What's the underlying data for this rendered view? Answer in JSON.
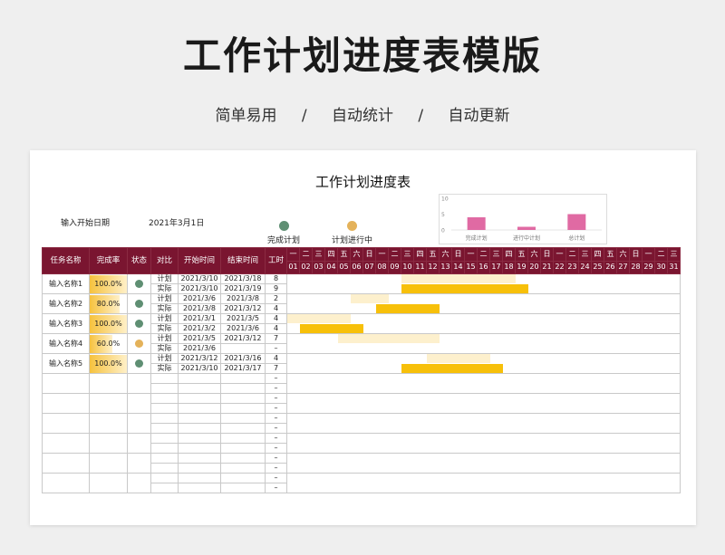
{
  "header": {
    "title": "工作计划进度表模版",
    "tags": [
      "简单易用",
      "自动统计",
      "自动更新"
    ],
    "separator": "/"
  },
  "sheet": {
    "title": "工作计划进度表",
    "start_label": "输入开始日期",
    "start_value": "2021年3月1日",
    "legend": [
      {
        "label": "完成计划",
        "icon": "check-circle-icon"
      },
      {
        "label": "计划进行中",
        "icon": "pending-circle-icon"
      }
    ]
  },
  "mini_chart": {
    "type": "bar",
    "categories": [
      "完成计划",
      "进行中计划",
      "总计划"
    ],
    "values": [
      4,
      1,
      5
    ],
    "y_ticks": [
      "10",
      "5",
      "0"
    ],
    "ylim": [
      0,
      10
    ],
    "color": "#e06aa3"
  },
  "table": {
    "columns": [
      "任务名称",
      "完成率",
      "状态",
      "对比",
      "开始时间",
      "结束时间",
      "工时"
    ],
    "weekdays": [
      "一",
      "二",
      "三",
      "四",
      "五",
      "六",
      "日",
      "一",
      "二",
      "三",
      "四",
      "五",
      "六",
      "日",
      "一",
      "二",
      "三",
      "四",
      "五",
      "六",
      "日",
      "一",
      "二",
      "三",
      "四",
      "五",
      "六",
      "日",
      "一",
      "二",
      "三"
    ],
    "days": [
      "01",
      "02",
      "03",
      "04",
      "05",
      "06",
      "07",
      "08",
      "09",
      "10",
      "11",
      "12",
      "13",
      "14",
      "15",
      "16",
      "17",
      "18",
      "19",
      "20",
      "21",
      "22",
      "23",
      "24",
      "25",
      "26",
      "27",
      "28",
      "29",
      "30",
      "31"
    ],
    "tasks": [
      {
        "name": "输入名称1",
        "rate": "100.0%",
        "rate_value": 1.0,
        "status": "done",
        "plan": {
          "label": "计划",
          "start": "2021/3/10",
          "end": "2021/3/18",
          "hours": "8",
          "from": 10,
          "to": 18
        },
        "actual": {
          "label": "实际",
          "start": "2021/3/10",
          "end": "2021/3/19",
          "hours": "9",
          "from": 10,
          "to": 19
        }
      },
      {
        "name": "输入名称2",
        "rate": "80.0%",
        "rate_value": 0.8,
        "status": "done",
        "plan": {
          "label": "计划",
          "start": "2021/3/6",
          "end": "2021/3/8",
          "hours": "2",
          "from": 6,
          "to": 8
        },
        "actual": {
          "label": "实际",
          "start": "2021/3/8",
          "end": "2021/3/12",
          "hours": "4",
          "from": 8,
          "to": 12
        }
      },
      {
        "name": "输入名称3",
        "rate": "100.0%",
        "rate_value": 1.0,
        "status": "done",
        "plan": {
          "label": "计划",
          "start": "2021/3/1",
          "end": "2021/3/5",
          "hours": "4",
          "from": 1,
          "to": 5
        },
        "actual": {
          "label": "实际",
          "start": "2021/3/2",
          "end": "2021/3/6",
          "hours": "4",
          "from": 2,
          "to": 6
        }
      },
      {
        "name": "输入名称4",
        "rate": "60.0%",
        "rate_value": 0.6,
        "status": "wip",
        "plan": {
          "label": "计划",
          "start": "2021/3/5",
          "end": "2021/3/12",
          "hours": "7",
          "from": 5,
          "to": 12
        },
        "actual": {
          "label": "实际",
          "start": "2021/3/6",
          "end": "",
          "hours": "–",
          "from": 0,
          "to": 0
        }
      },
      {
        "name": "输入名称5",
        "rate": "100.0%",
        "rate_value": 1.0,
        "status": "done",
        "plan": {
          "label": "计划",
          "start": "2021/3/12",
          "end": "2021/3/16",
          "hours": "4",
          "from": 12,
          "to": 16
        },
        "actual": {
          "label": "实际",
          "start": "2021/3/10",
          "end": "2021/3/17",
          "hours": "7",
          "from": 10,
          "to": 17
        }
      }
    ],
    "empty_hours": "–",
    "empty_groups": 6
  },
  "colors": {
    "header_bg": "#7a1530",
    "plan_bar": "#fdf0cd",
    "actual_bar": "#f7c00a",
    "done": "#5f8f73",
    "wip": "#e4b25a"
  }
}
